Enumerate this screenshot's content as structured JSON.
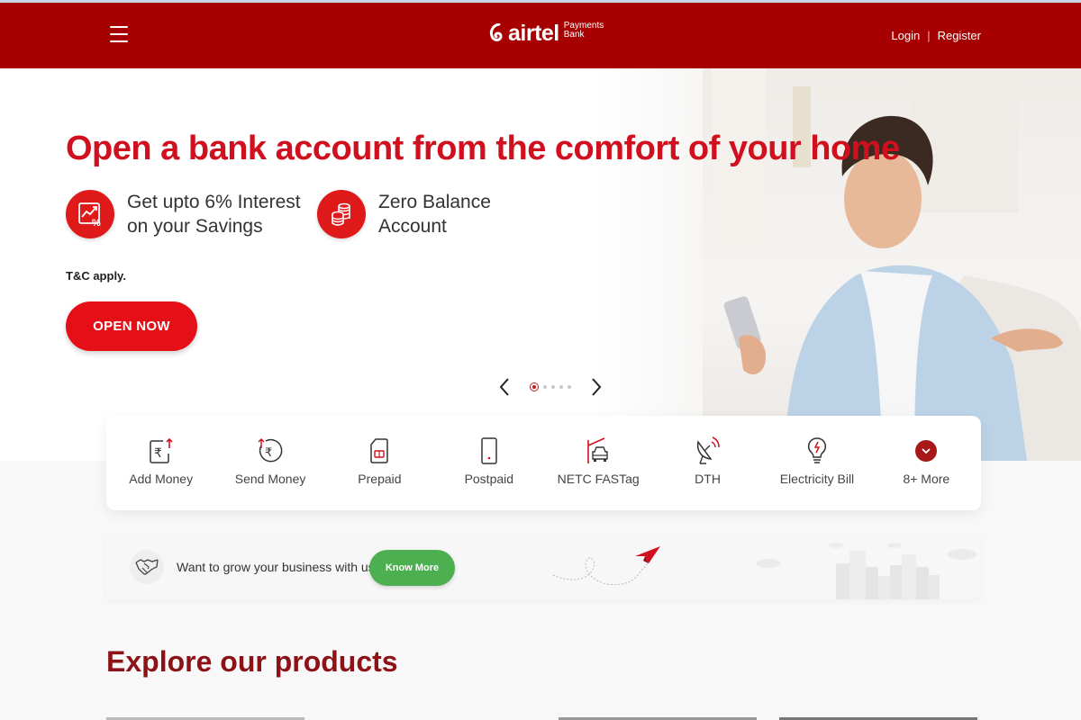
{
  "header": {
    "menu_icon": "hamburger-menu-icon",
    "logo": {
      "word": "airtel",
      "sub_line1": "Payments",
      "sub_line2": "Bank"
    },
    "login_label": "Login",
    "separator": "|",
    "register_label": "Register",
    "brand_color": "#a60000"
  },
  "hero": {
    "title": "Open a bank account from the comfort of your home",
    "features": [
      {
        "icon": "interest-growth-icon",
        "line1": "Get upto 6% Interest",
        "line2": "on your Savings"
      },
      {
        "icon": "coins-stack-icon",
        "line1": "Zero Balance",
        "line2": "Account"
      }
    ],
    "tnc": "T&C apply.",
    "cta_label": "OPEN NOW",
    "accent_color": "#e40f17",
    "carousel": {
      "slides": 5,
      "active_index": 0
    }
  },
  "services": [
    {
      "label": "Add Money",
      "icon": "add-money-icon"
    },
    {
      "label": "Send Money",
      "icon": "send-money-icon"
    },
    {
      "label": "Prepaid",
      "icon": "sim-card-icon"
    },
    {
      "label": "Postpaid",
      "icon": "mobile-phone-icon"
    },
    {
      "label": "NETC FASTag",
      "icon": "toll-car-icon"
    },
    {
      "label": "DTH",
      "icon": "satellite-dish-icon"
    },
    {
      "label": "Electricity Bill",
      "icon": "bulb-icon"
    },
    {
      "label": "8+ More",
      "icon": "chevron-down-icon"
    }
  ],
  "business": {
    "icon": "handshake-icon",
    "text": "Want to grow your business with us?",
    "button_label": "Know More",
    "button_color": "#4caf50"
  },
  "explore": {
    "title": "Explore our products"
  }
}
